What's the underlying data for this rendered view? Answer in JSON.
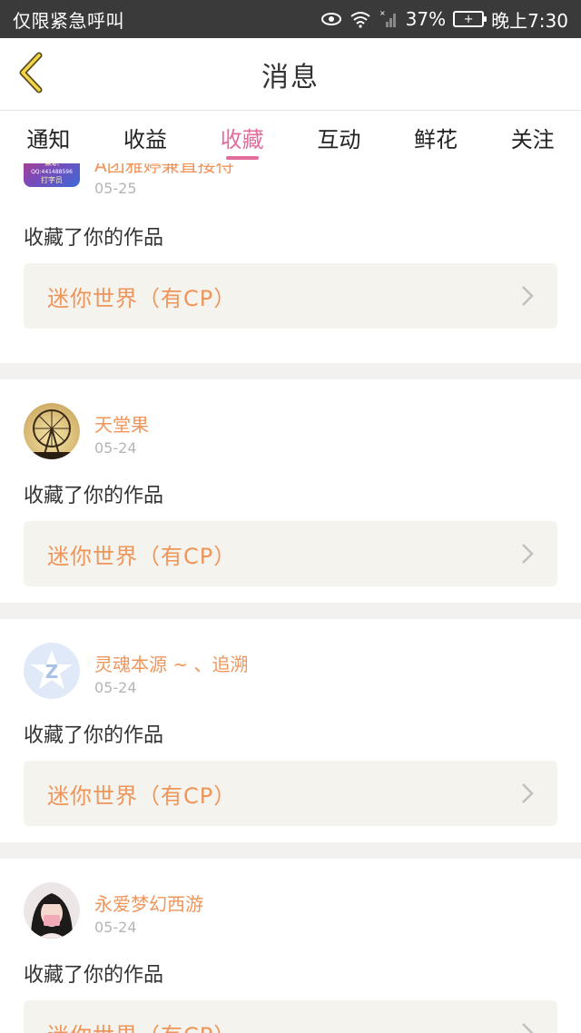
{
  "status_bar": {
    "carrier": "仅限紧急呼叫",
    "battery_percent": "37%",
    "time": "晚上7:30"
  },
  "header": {
    "title": "消息"
  },
  "tabs": [
    {
      "label": "通知",
      "active": false
    },
    {
      "label": "收益",
      "active": false
    },
    {
      "label": "收藏",
      "active": true
    },
    {
      "label": "互动",
      "active": false
    },
    {
      "label": "鲜花",
      "active": false
    },
    {
      "label": "关注",
      "active": false
    }
  ],
  "items": [
    {
      "username": "A团雅婷兼直接待",
      "date": "05-25",
      "action": "收藏了你的作品",
      "work_title": "迷你世界（有CP）",
      "avatar_text": [
        "招聘",
        "兼职",
        "QQ:441488596",
        "打字员"
      ]
    },
    {
      "username": "天堂果",
      "date": "05-24",
      "action": "收藏了你的作品",
      "work_title": "迷你世界（有CP）"
    },
    {
      "username": "灵魂本源 ~ 、追溯",
      "date": "05-24",
      "action": "收藏了你的作品",
      "work_title": "迷你世界（有CP）"
    },
    {
      "username": "永爱梦幻西游",
      "date": "05-24",
      "action": "收藏了你的作品",
      "work_title": "迷你世界（有CP）"
    }
  ],
  "colors": {
    "accent_pink": "#e26c9c",
    "username_orange": "#f0955a",
    "status_bar_bg": "#3a3a3a",
    "card_box_bg": "#f4f3ee"
  }
}
